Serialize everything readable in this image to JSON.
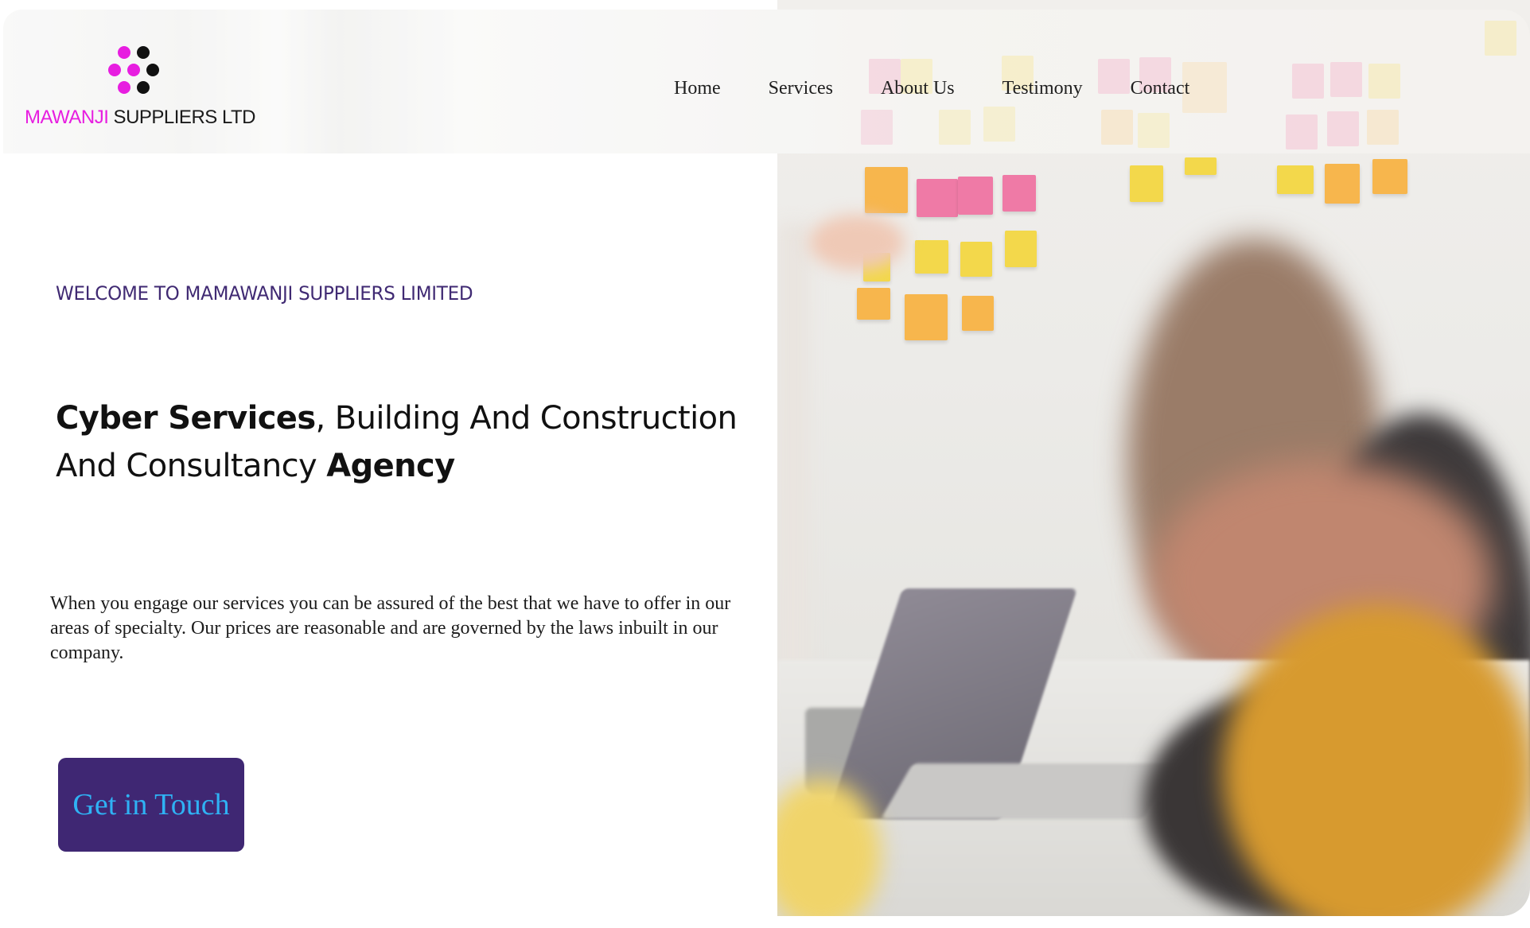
{
  "brand": {
    "name_part1": "MAWANJI",
    "name_part2": " SUPPLIERS LTD",
    "colors": {
      "magenta": "#e71ee0",
      "black": "#1b1b1b"
    },
    "icon": "dots-logo-icon"
  },
  "nav": {
    "items": [
      {
        "label": "Home"
      },
      {
        "label": "Services"
      },
      {
        "label": "About Us"
      },
      {
        "label": "Testimony"
      },
      {
        "label": "Contact"
      }
    ]
  },
  "hero": {
    "welcome": "WELCOME TO MAMAWANJI  SUPPLIERS LIMITED",
    "headline": {
      "part1_bold": "Cyber Services",
      "part2": ", Building And Construction And Consultancy ",
      "part3_bold": "Agency"
    },
    "description": "When you engage our services you can be assured of the best that we have to offer in our areas of specialty. Our prices are reasonable and are governed by the laws inbuilt in our company.",
    "cta_label": "Get in Touch",
    "colors": {
      "accent": "#402a73",
      "cta_background": "#3f2773",
      "cta_text": "#2fb2f4"
    }
  }
}
